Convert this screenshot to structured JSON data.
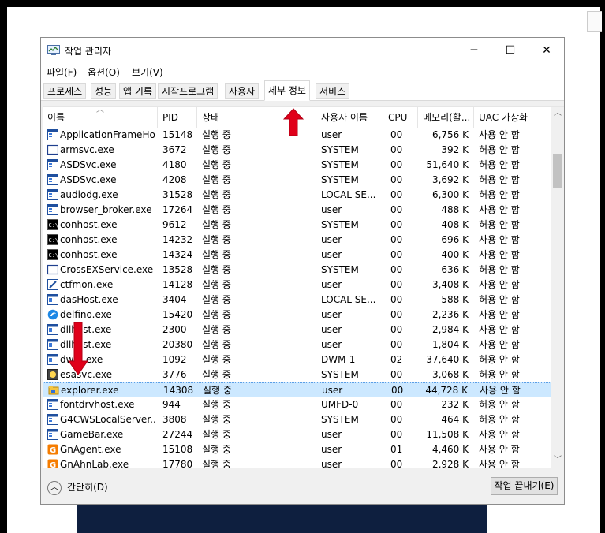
{
  "window": {
    "title": "작업 관리자",
    "controls": {
      "minimize": "─",
      "maximize": "☐",
      "close": "✕"
    }
  },
  "menu": [
    "파일(F)",
    "옵션(O)",
    "보기(V)"
  ],
  "tabs": [
    "프로세스",
    "성능",
    "앱 기록",
    "시작프로그램",
    "사용자",
    "세부 정보",
    "서비스"
  ],
  "active_tab": "세부 정보",
  "columns": [
    "이름",
    "PID",
    "상태",
    "사용자 이름",
    "CPU",
    "메모리(활...",
    "UAC 가상화"
  ],
  "processes": [
    {
      "name": "ApplicationFrameHo...",
      "pid": "15148",
      "status": "실행 중",
      "user": "user",
      "cpu": "00",
      "mem": "6,756 K",
      "uac": "사용 안 함",
      "icon": "window-icon"
    },
    {
      "name": "armsvc.exe",
      "pid": "3672",
      "status": "실행 중",
      "user": "SYSTEM",
      "cpu": "00",
      "mem": "392 K",
      "uac": "허용 안 함",
      "icon": "blank-window-icon"
    },
    {
      "name": "ASDSvc.exe",
      "pid": "4180",
      "status": "실행 중",
      "user": "SYSTEM",
      "cpu": "00",
      "mem": "51,640 K",
      "uac": "허용 안 함",
      "icon": "window-icon"
    },
    {
      "name": "ASDSvc.exe",
      "pid": "4208",
      "status": "실행 중",
      "user": "SYSTEM",
      "cpu": "00",
      "mem": "3,692 K",
      "uac": "허용 안 함",
      "icon": "window-icon"
    },
    {
      "name": "audiodg.exe",
      "pid": "31528",
      "status": "실행 중",
      "user": "LOCAL SE...",
      "cpu": "00",
      "mem": "6,300 K",
      "uac": "허용 안 함",
      "icon": "window-icon"
    },
    {
      "name": "browser_broker.exe",
      "pid": "17264",
      "status": "실행 중",
      "user": "user",
      "cpu": "00",
      "mem": "488 K",
      "uac": "사용 안 함",
      "icon": "window-icon"
    },
    {
      "name": "conhost.exe",
      "pid": "9612",
      "status": "실행 중",
      "user": "SYSTEM",
      "cpu": "00",
      "mem": "408 K",
      "uac": "허용 안 함",
      "icon": "console-icon"
    },
    {
      "name": "conhost.exe",
      "pid": "14232",
      "status": "실행 중",
      "user": "user",
      "cpu": "00",
      "mem": "696 K",
      "uac": "사용 안 함",
      "icon": "console-icon"
    },
    {
      "name": "conhost.exe",
      "pid": "14324",
      "status": "실행 중",
      "user": "user",
      "cpu": "00",
      "mem": "400 K",
      "uac": "사용 안 함",
      "icon": "console-icon"
    },
    {
      "name": "CrossEXService.exe",
      "pid": "13528",
      "status": "실행 중",
      "user": "SYSTEM",
      "cpu": "00",
      "mem": "636 K",
      "uac": "허용 안 함",
      "icon": "blank-window-icon"
    },
    {
      "name": "ctfmon.exe",
      "pid": "14128",
      "status": "실행 중",
      "user": "user",
      "cpu": "00",
      "mem": "3,408 K",
      "uac": "사용 안 함",
      "icon": "pen-icon"
    },
    {
      "name": "dasHost.exe",
      "pid": "3404",
      "status": "실행 중",
      "user": "LOCAL SE...",
      "cpu": "00",
      "mem": "588 K",
      "uac": "허용 안 함",
      "icon": "window-icon"
    },
    {
      "name": "delfino.exe",
      "pid": "15420",
      "status": "실행 중",
      "user": "user",
      "cpu": "00",
      "mem": "2,236 K",
      "uac": "사용 안 함",
      "icon": "delfino-icon"
    },
    {
      "name": "dllhost.exe",
      "pid": "2300",
      "status": "실행 중",
      "user": "user",
      "cpu": "00",
      "mem": "2,984 K",
      "uac": "사용 안 함",
      "icon": "window-icon"
    },
    {
      "name": "dllhost.exe",
      "pid": "20380",
      "status": "실행 중",
      "user": "user",
      "cpu": "00",
      "mem": "1,804 K",
      "uac": "사용 안 함",
      "icon": "window-icon"
    },
    {
      "name": "dwm.exe",
      "pid": "1092",
      "status": "실행 중",
      "user": "DWM-1",
      "cpu": "02",
      "mem": "37,640 K",
      "uac": "허용 안 함",
      "icon": "window-icon"
    },
    {
      "name": "esasvc.exe",
      "pid": "3776",
      "status": "실행 중",
      "user": "SYSTEM",
      "cpu": "00",
      "mem": "3,068 K",
      "uac": "허용 안 함",
      "icon": "esa-icon"
    },
    {
      "name": "explorer.exe",
      "pid": "14308",
      "status": "실행 중",
      "user": "user",
      "cpu": "00",
      "mem": "44,728 K",
      "uac": "사용 안 함",
      "icon": "folder-icon"
    },
    {
      "name": "fontdrvhost.exe",
      "pid": "944",
      "status": "실행 중",
      "user": "UMFD-0",
      "cpu": "00",
      "mem": "232 K",
      "uac": "허용 안 함",
      "icon": "window-icon"
    },
    {
      "name": "G4CWSLocalServer....",
      "pid": "3808",
      "status": "실행 중",
      "user": "SYSTEM",
      "cpu": "00",
      "mem": "464 K",
      "uac": "허용 안 함",
      "icon": "window-icon"
    },
    {
      "name": "GameBar.exe",
      "pid": "27244",
      "status": "실행 중",
      "user": "user",
      "cpu": "00",
      "mem": "11,508 K",
      "uac": "사용 안 함",
      "icon": "window-icon"
    },
    {
      "name": "GnAgent.exe",
      "pid": "15108",
      "status": "실행 중",
      "user": "user",
      "cpu": "01",
      "mem": "4,460 K",
      "uac": "사용 안 함",
      "icon": "g-orange-icon"
    },
    {
      "name": "GnAhnLab.exe",
      "pid": "17780",
      "status": "실행 중",
      "user": "user",
      "cpu": "00",
      "mem": "2,928 K",
      "uac": "사용 안 함",
      "icon": "g-orange-icon"
    }
  ],
  "selected_index": 17,
  "footer": {
    "collapse_label": "간단히(D)",
    "end_task_label": "작업 끝내기(E)"
  },
  "colors": {
    "selected_row": "#cce8ff",
    "annotation_arrow": "#e0001a"
  }
}
